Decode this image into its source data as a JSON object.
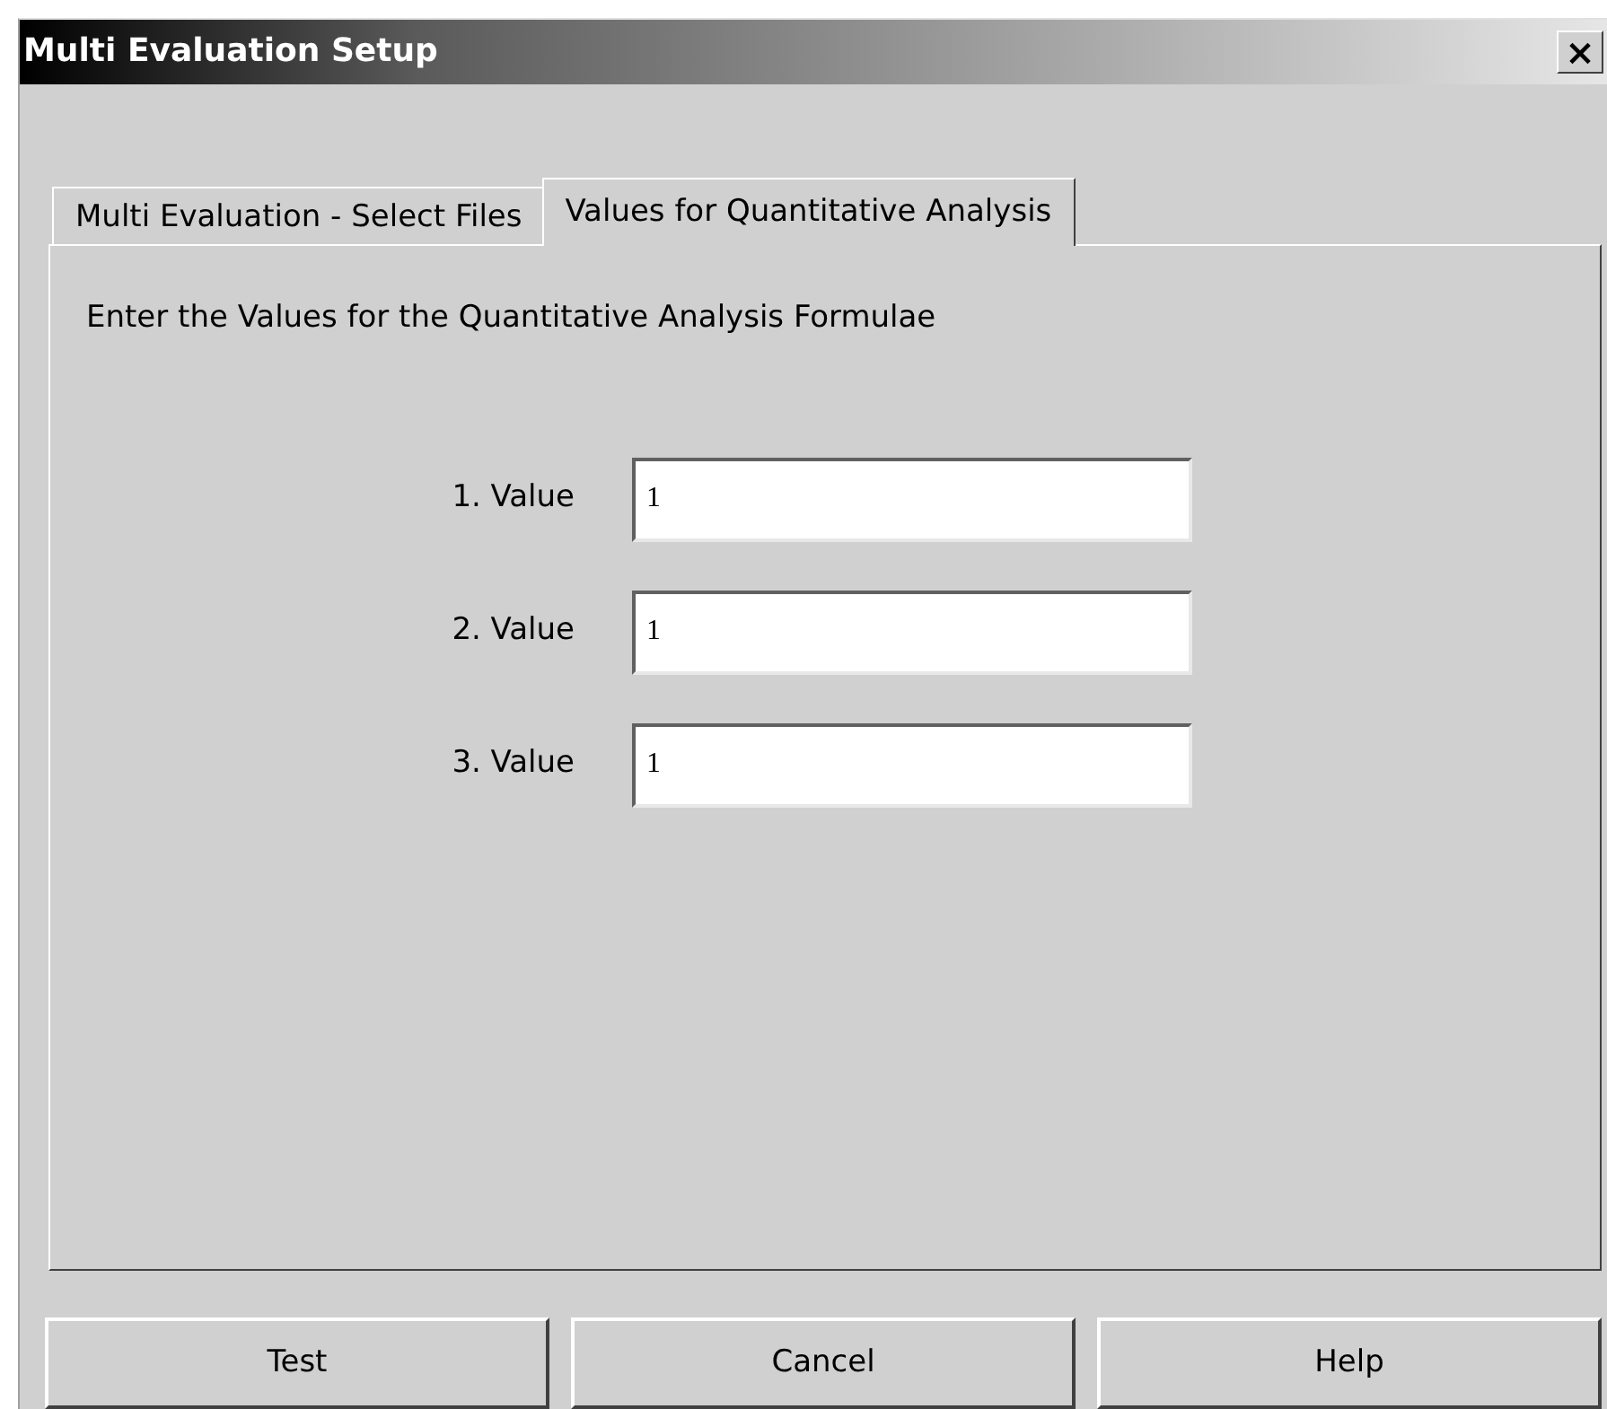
{
  "window": {
    "title": "Multi Evaluation Setup",
    "close": "×"
  },
  "tabs": [
    {
      "label": "Multi Evaluation - Select Files",
      "selected": false
    },
    {
      "label": "Values for Quantitative Analysis",
      "selected": true
    }
  ],
  "instruction": "Enter the Values for the Quantitative Analysis Formulae",
  "fields": [
    {
      "label": "1. Value",
      "value": "1"
    },
    {
      "label": "2. Value",
      "value": "1"
    },
    {
      "label": "3. Value",
      "value": "1"
    }
  ],
  "buttons": [
    "Test",
    "Cancel",
    "Help"
  ]
}
